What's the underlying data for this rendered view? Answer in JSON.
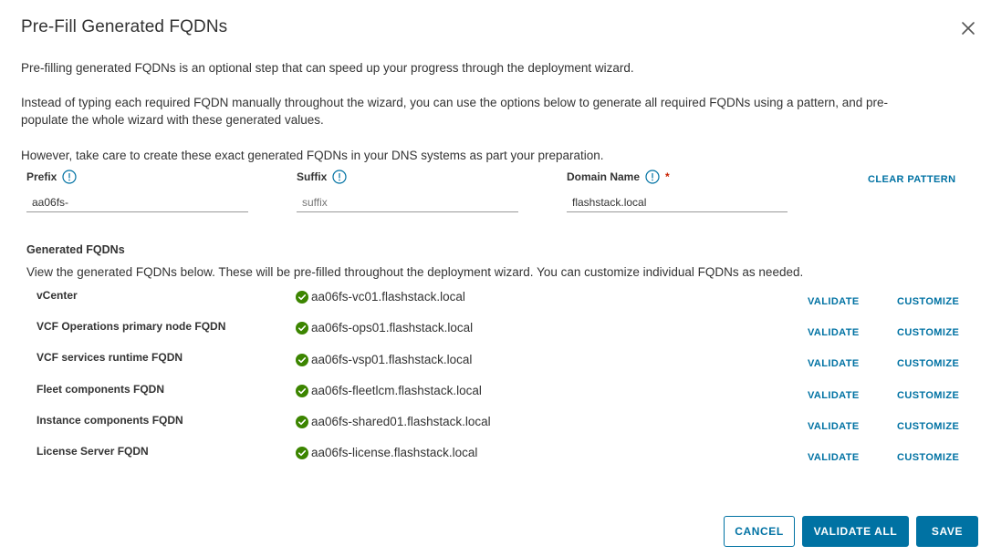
{
  "dialog": {
    "title": "Pre-Fill Generated FQDNs",
    "intro1": "Pre-filling generated FQDNs is an optional step that can speed up your progress through the deployment wizard.",
    "intro2a": "Instead of typing each required FQDN manually throughout the wizard, you can use the options below to generate all required FQDNs using a pattern, and pre-",
    "intro2b": "populate the whole wizard with these generated values.",
    "intro3": "However, take care to create these exact generated FQDNs in your DNS systems as part your preparation."
  },
  "pattern": {
    "prefix_label": "Prefix",
    "prefix_value": "aa06fs-",
    "suffix_label": "Suffix",
    "suffix_value": "",
    "suffix_placeholder": "suffix",
    "domain_label": "Domain Name",
    "domain_required_mark": "*",
    "domain_value": "flashstack.local",
    "clear_label": "CLEAR PATTERN"
  },
  "generated": {
    "title": "Generated FQDNs",
    "description": "View the generated FQDNs below. These will be pre-filled throughout the deployment wizard. You can customize individual FQDNs as needed.",
    "validate_label": "VALIDATE",
    "customize_label": "CUSTOMIZE",
    "rows": [
      {
        "label": "vCenter",
        "value": "aa06fs-vc01.flashstack.local"
      },
      {
        "label": "VCF Operations primary node FQDN",
        "value": "aa06fs-ops01.flashstack.local"
      },
      {
        "label": "VCF services runtime FQDN",
        "value": "aa06fs-vsp01.flashstack.local"
      },
      {
        "label": "Fleet components FQDN",
        "value": "aa06fs-fleetlcm.flashstack.local"
      },
      {
        "label": "Instance components FQDN",
        "value": "aa06fs-shared01.flashstack.local"
      },
      {
        "label": "License Server FQDN",
        "value": "aa06fs-license.flashstack.local"
      }
    ]
  },
  "footer": {
    "cancel_label": "CANCEL",
    "validate_all_label": "VALIDATE ALL",
    "save_label": "SAVE"
  },
  "colors": {
    "accent": "#0072a3",
    "success": "#3c8500",
    "required": "#c92100"
  },
  "icons": {
    "close": "close-icon",
    "info": "info-icon",
    "valid": "check-circle-icon"
  }
}
